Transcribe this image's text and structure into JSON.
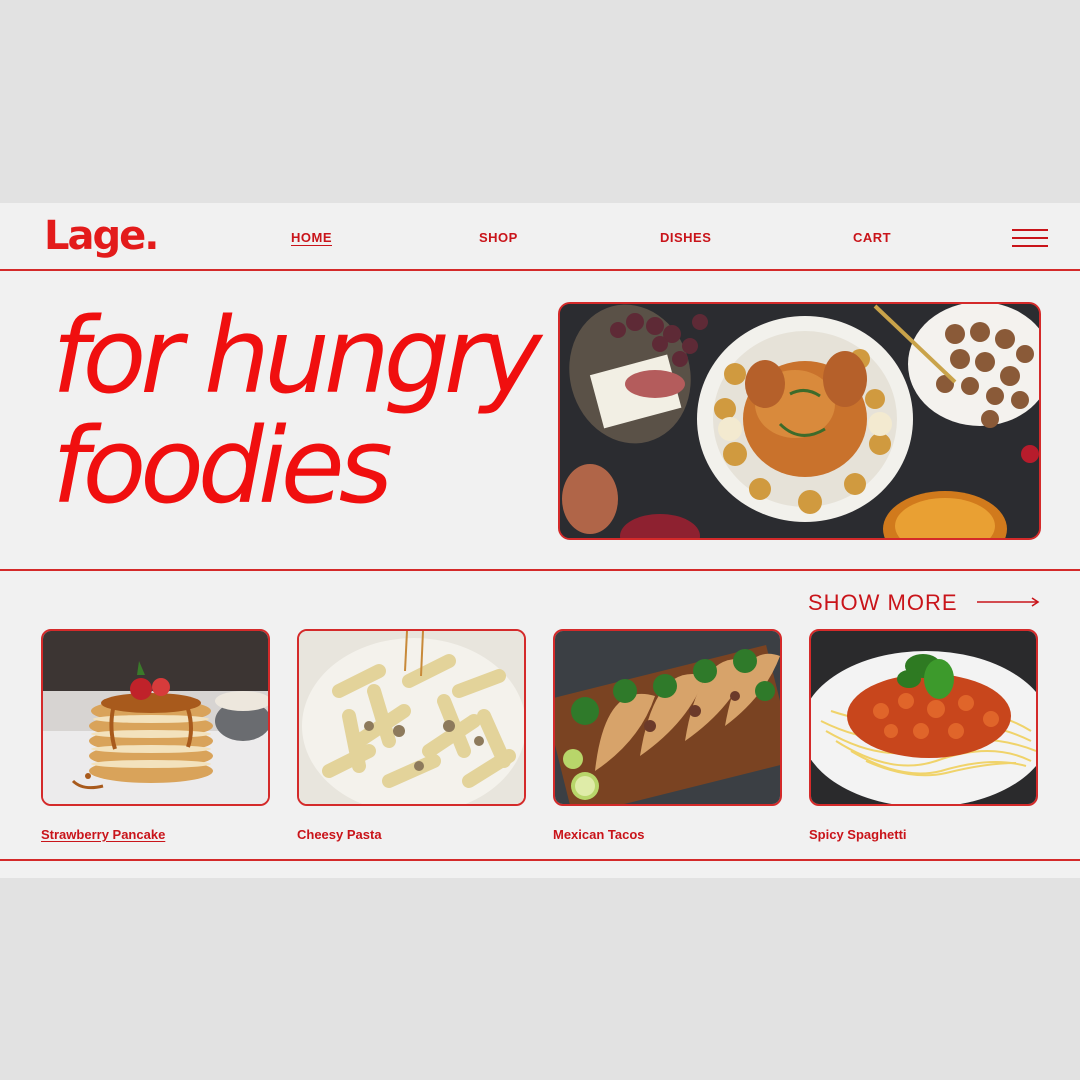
{
  "brand": {
    "logo": "Lage."
  },
  "nav": {
    "items": [
      {
        "label": "HOME",
        "active": true
      },
      {
        "label": "SHOP",
        "active": false
      },
      {
        "label": "DISHES",
        "active": false
      },
      {
        "label": "CART",
        "active": false
      }
    ],
    "menu_icon": "hamburger-menu-icon"
  },
  "hero": {
    "line1": "for hungry",
    "line2": "foodies",
    "image_alt": "roast-chicken-feast-image"
  },
  "dishes": {
    "show_more_label": "SHOW MORE",
    "arrow_icon": "long-right-arrow-icon",
    "items": [
      {
        "label": "Strawberry Pancake",
        "active": true
      },
      {
        "label": "Cheesy Pasta",
        "active": false
      },
      {
        "label": "Mexican Tacos",
        "active": false
      },
      {
        "label": "Spicy Spaghetti",
        "active": false
      }
    ]
  },
  "colors": {
    "accent": "#e31b1b",
    "border": "#d42a2a",
    "page_bg": "#f1f1f1",
    "outer_bg": "#e2e2e2"
  }
}
